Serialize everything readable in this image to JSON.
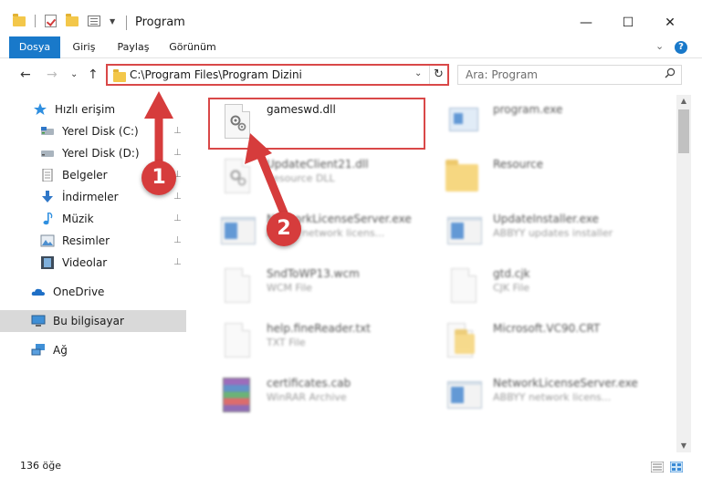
{
  "window": {
    "title": "Program",
    "minimize": "—",
    "maximize": "☐",
    "close": "✕"
  },
  "ribbon": {
    "tabs": [
      "Dosya",
      "Giriş",
      "Paylaş",
      "Görünüm"
    ],
    "active_index": 0,
    "expand": "⌄",
    "help": "?"
  },
  "nav": {
    "back": "←",
    "forward": "→",
    "recent": "⌄",
    "up": "↑",
    "address": "C:\\Program Files\\Program Dizini",
    "address_chevron": "⌄",
    "refresh": "↻",
    "search_placeholder": "Ara: Program"
  },
  "sidebar": {
    "items": [
      {
        "label": "Hızlı erişim",
        "icon": "star-icon",
        "pinned": false
      },
      {
        "label": "Yerel Disk (C:)",
        "icon": "drive-icon",
        "pinned": true
      },
      {
        "label": "Yerel Disk (D:)",
        "icon": "drive-icon",
        "pinned": true
      },
      {
        "label": "Belgeler",
        "icon": "document-icon",
        "pinned": true
      },
      {
        "label": "İndirmeler",
        "icon": "download-icon",
        "pinned": true
      },
      {
        "label": "Müzik",
        "icon": "music-icon",
        "pinned": true
      },
      {
        "label": "Resimler",
        "icon": "pictures-icon",
        "pinned": true
      },
      {
        "label": "Videolar",
        "icon": "video-icon",
        "pinned": true
      },
      {
        "label": "OneDrive",
        "icon": "cloud-icon",
        "pinned": false
      },
      {
        "label": "Bu bilgisayar",
        "icon": "computer-icon",
        "pinned": false,
        "selected": true
      },
      {
        "label": "Ağ",
        "icon": "network-icon",
        "pinned": false
      }
    ],
    "pin_glyph": "📌"
  },
  "files": [
    {
      "name": "gameswd.dll",
      "desc": "",
      "icon": "dll-gear-icon",
      "highlighted": true
    },
    {
      "name": "program.exe",
      "desc": "",
      "icon": "exe-icon"
    },
    {
      "name": "UpdateClient21.dll",
      "desc": "Resource DLL",
      "icon": "dll-gear-icon"
    },
    {
      "name": "Resource",
      "desc": "",
      "icon": "folder-icon"
    },
    {
      "name": "NetworkLicenseServer.exe",
      "desc": "ABBYY network licens...",
      "icon": "app-window-icon"
    },
    {
      "name": "UpdateInstaller.exe",
      "desc": "ABBYY updates installer",
      "icon": "app-window-icon"
    },
    {
      "name": "SndToWP13.wcm",
      "desc": "WCM File",
      "icon": "blank-file-icon"
    },
    {
      "name": "gtd.cjk",
      "desc": "CJK File",
      "icon": "blank-file-icon"
    },
    {
      "name": "help.fineReader.txt",
      "desc": "TXT File",
      "icon": "blank-file-icon"
    },
    {
      "name": "Microsoft.VC90.CRT",
      "desc": "",
      "icon": "folder-icon"
    },
    {
      "name": "certificates.cab",
      "desc": "WinRAR Archive",
      "icon": "rar-archive-icon"
    },
    {
      "name": "NetworkLicenseServer.exe",
      "desc": "ABBYY network licens...",
      "icon": "app-window-icon"
    }
  ],
  "status": {
    "count": "136 öğe"
  },
  "annotations": {
    "badge_1": "1",
    "badge_2": "2",
    "color": "#d63c3c"
  }
}
